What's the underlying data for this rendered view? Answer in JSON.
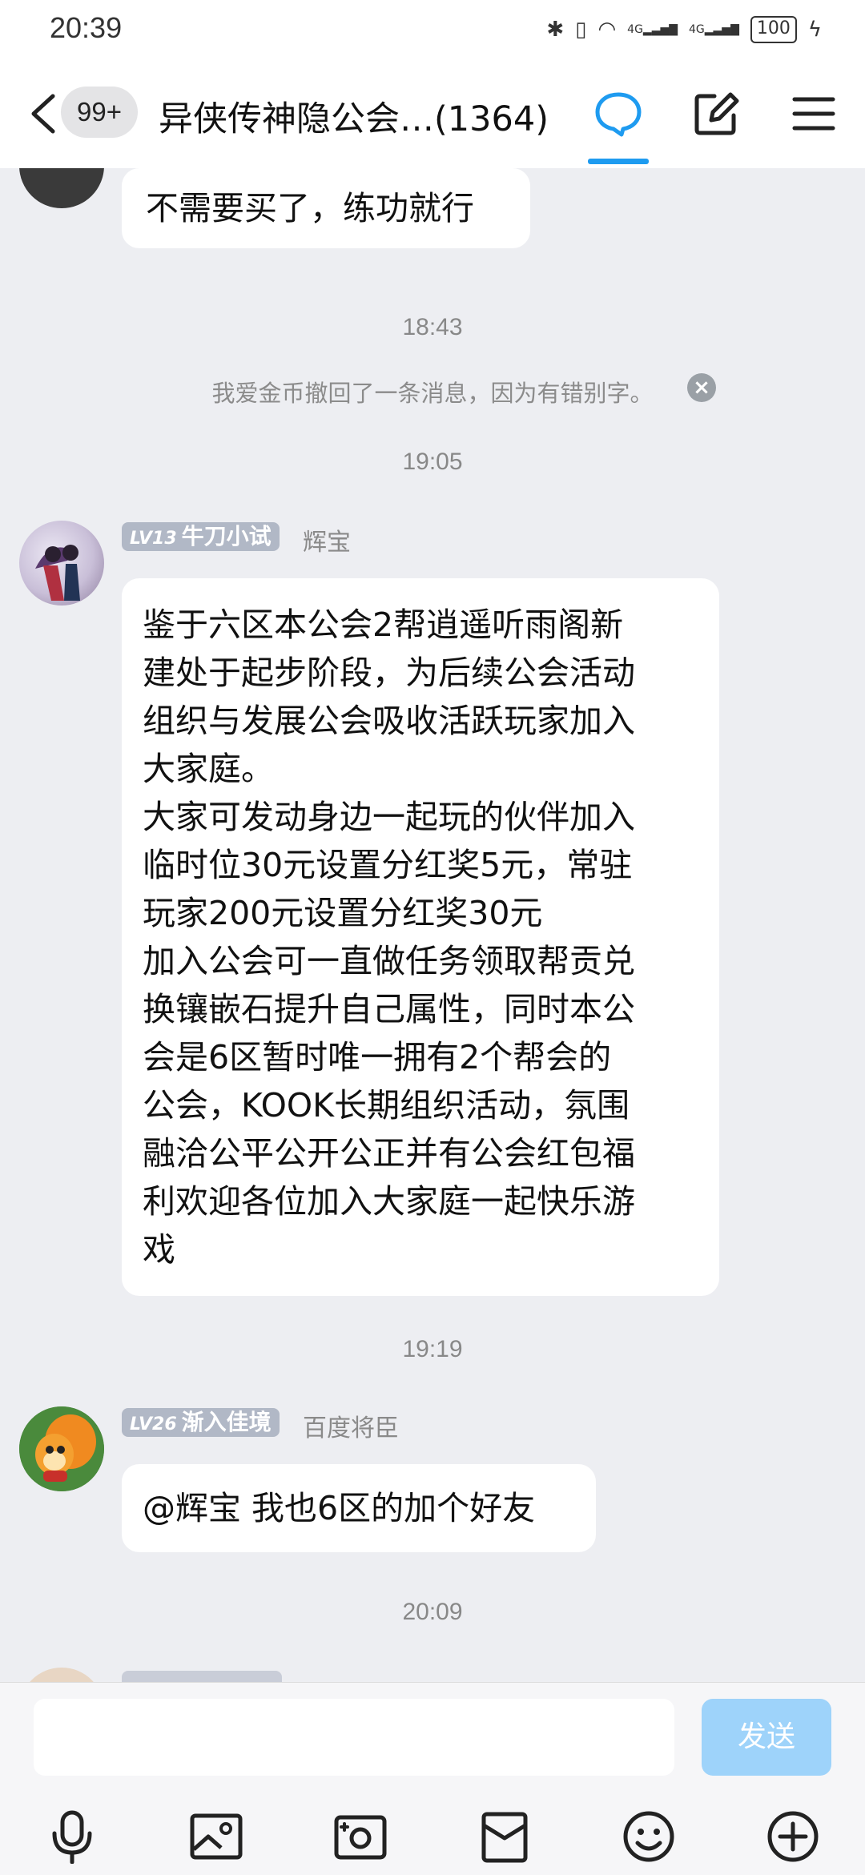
{
  "status_bar": {
    "time": "20:39",
    "signal1": "4G",
    "signal2": "4G",
    "battery": "100"
  },
  "header": {
    "unread_badge": "99+",
    "title": "异侠传神隐公会…(1364)"
  },
  "messages": {
    "m1_text": "不需要买了，练功就行",
    "time1": "18:43",
    "recall_text": "我爱金币撤回了一条消息，因为有错别字。",
    "time2": "19:05",
    "m2_level": "LV13",
    "m2_name": "牛刀小试",
    "m2_nick": "辉宝",
    "m2_lines": [
      "鉴于六区本公会2帮逍遥听雨阁新",
      "建处于起步阶段，为后续公会活动",
      "组织与发展公会吸收活跃玩家加入",
      "大家庭。",
      "大家可发动身边一起玩的伙伴加入",
      "临时位30元设置分红奖5元，常驻",
      "玩家200元设置分红奖30元",
      "加入公会可一直做任务领取帮贡兑",
      "换镶嵌石提升自己属性，同时本公",
      "会是6区暂时唯一拥有2个帮会的",
      "公会，KOOK长期组织活动，氛围",
      "融洽公平公开公正并有公会红包福",
      "利欢迎各位加入大家庭一起快乐游",
      "戏"
    ],
    "time3": "19:19",
    "m3_level": "LV26",
    "m3_name": "渐入佳境",
    "m3_nick": "百度将臣",
    "m3_text": "@辉宝 我也6区的加个好友",
    "time4": "20:09"
  },
  "input_bar": {
    "send_label": "发送"
  },
  "colors": {
    "accent": "#1E9BF0",
    "send_disabled": "#9ED3FA",
    "background": "#EDEEF2",
    "level_badge": "#B1B8C6"
  },
  "icons": [
    "back-icon",
    "chat-icon",
    "edit-icon",
    "menu-icon",
    "mic-icon",
    "image-icon",
    "camera-icon",
    "file-icon",
    "emoji-icon",
    "plus-icon"
  ]
}
